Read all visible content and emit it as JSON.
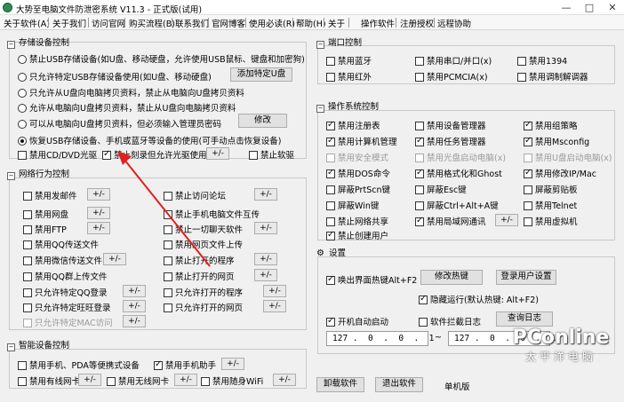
{
  "window": {
    "title": "大势至电脑文件防泄密系统 V11.3 - 正式版(试用)",
    "minimize": "—",
    "maximize": "□",
    "close": "✕"
  },
  "menu": [
    "关于软件(A)",
    "关于我们",
    "访问官网",
    "购买流程(B)",
    "联系我们",
    "官网博客",
    "使用必读(R)",
    "帮助(H)",
    "关于",
    "操作软件",
    "注册授权",
    "远程协助"
  ],
  "storage": {
    "header": "存储设备控制",
    "options": [
      "禁止USB存储设备(如U盘、移动硬盘，允许使用USB鼠标、键盘和加密狗)",
      "只允许特定USB存储设备使用(如U盘、移动硬盘)",
      "只允许从U盘向电脑拷贝资料，禁止从电脑向U盘拷贝资料",
      "允许从电脑向U盘拷贝资料，禁止从U盘向电脑拷贝资料",
      "可以从电脑向U盘拷贝资料，但必须输入管理员密码",
      "恢复USB存储设备、手机或蓝牙等设备的使用(可手动点击恢复设备)"
    ],
    "add_usb_button": "添加特定U盘",
    "modify_button": "修改",
    "cd_dvd": "禁用CD/DVD光驱",
    "burn_only": "禁止刻录但允许光驱使用",
    "floppy": "禁止软驱",
    "plusminus": "+/-"
  },
  "network": {
    "header": "网络行为控制",
    "left": [
      "禁用发邮件",
      "禁用网盘",
      "禁用FTP",
      "禁用QQ传送文件",
      "禁用微信传送文件",
      "禁用QQ群上传文件",
      "只允许特定QQ登录",
      "只允许特定旺旺登录",
      "只允许特定MAC访问"
    ],
    "right": [
      "禁止访问论坛",
      "禁止手机电脑文件互传",
      "禁止一切聊天软件",
      "禁用网页文件上传",
      "禁止打开的程序",
      "禁止打开的网页",
      "只允许打开的程序",
      "只允许打开的网页"
    ]
  },
  "smart": {
    "header": "智能设备控制",
    "items": [
      "禁用手机、PDA等便携式设备",
      "禁用手机助手",
      "禁用有线网卡",
      "禁用无线网卡",
      "禁用随身WiFi"
    ]
  },
  "ports": {
    "header": "端口控制",
    "items": [
      "禁用蓝牙",
      "禁用串口/并口(x)",
      "禁用1394",
      "禁用红外",
      "禁用PCMCIA(x)",
      "禁用调制解调器"
    ]
  },
  "os": {
    "header": "操作系统控制",
    "items": [
      "禁用注册表",
      "禁用设备管理器",
      "禁用组策略",
      "禁用计算机管理",
      "禁用任务管理器",
      "禁用Msconfig",
      "禁用安全模式",
      "禁用光盘启动电脑(x)",
      "禁用U盘启动电脑(x)",
      "禁用DOS命令",
      "禁用格式化和Ghost",
      "禁用修改IP/Mac",
      "屏蔽PrtScn键",
      "屏蔽Esc键",
      "屏蔽剪贴板",
      "屏蔽Win键",
      "屏蔽Ctrl+Alt+A键",
      "禁用Telnet",
      "禁止网络共享",
      "禁用局域网通讯",
      "禁用虚拟机",
      "禁止创建用户"
    ]
  },
  "settings": {
    "header": "设置",
    "hotkey": "唤出界面热键Alt+F2",
    "modify_hotkey": "修改热键",
    "login_settings": "登录用户设置",
    "hidden_run": "隐藏运行(默认热键: Alt+F2)",
    "autostart": "开机自动启动",
    "software_log": "软件拦截日志",
    "query_log": "查询日志",
    "ip_start": "127 .  0  .  0  .  1",
    "ip_sep": "~",
    "ip_end": "127 .  0  .  0  .  1"
  },
  "footer": {
    "uninstall": "卸载软件",
    "exit": "退出软件",
    "edition": "单机版"
  },
  "watermark": {
    "logo": "PConline",
    "sub": "太平洋电脑"
  }
}
